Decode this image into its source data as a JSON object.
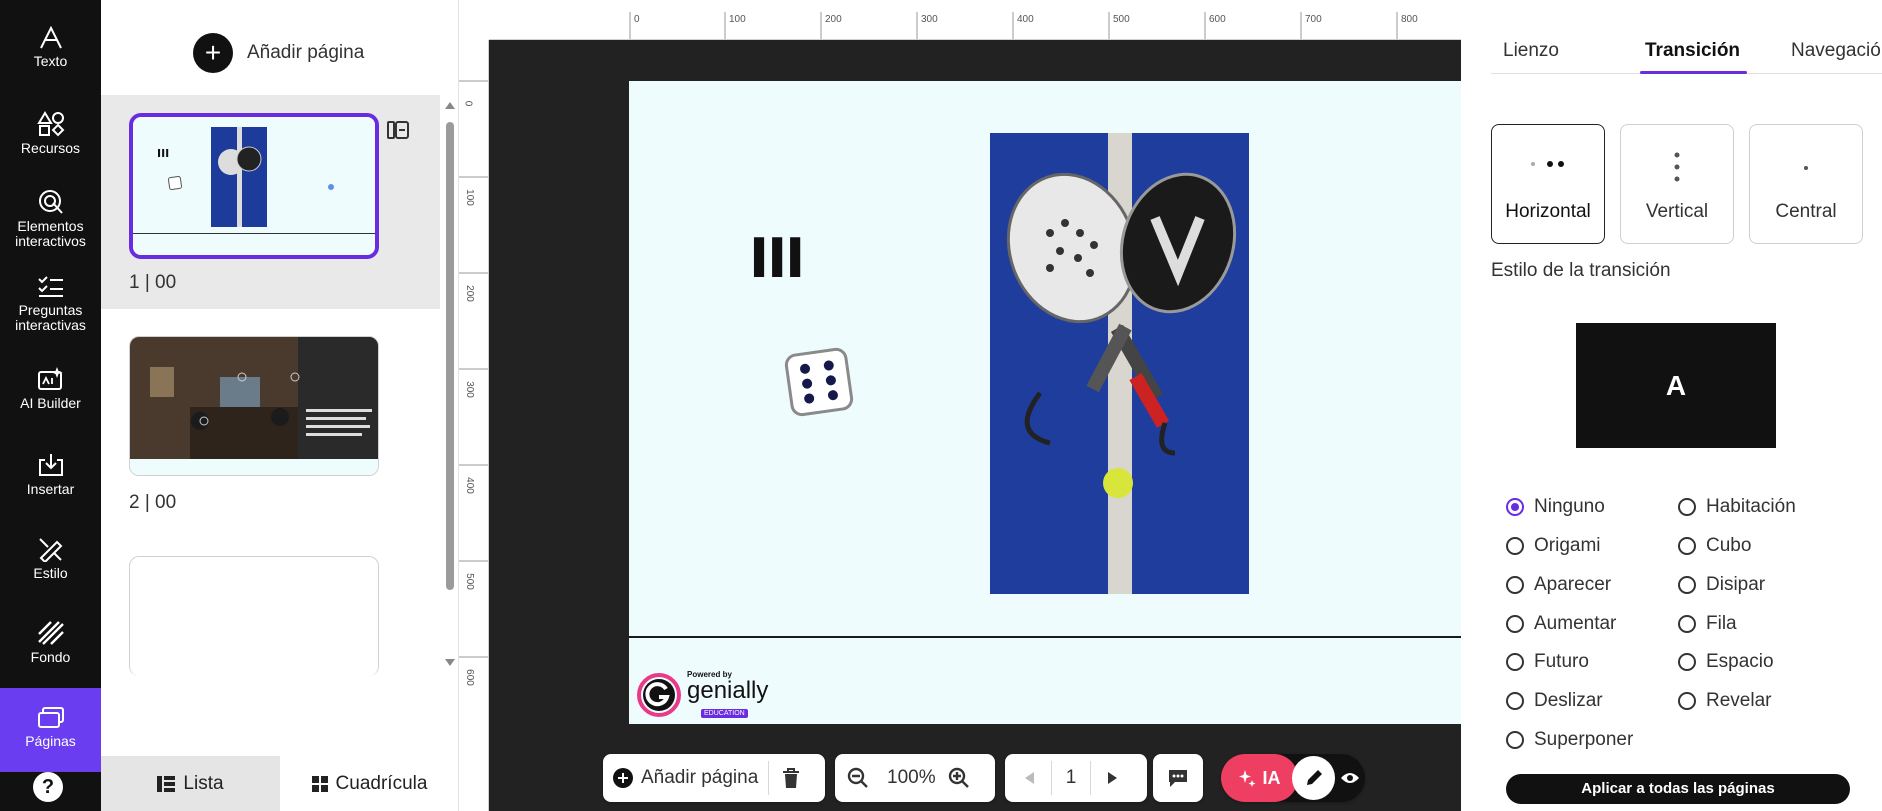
{
  "sidebar": {
    "tools": [
      {
        "label": "Texto",
        "icon": "text-icon"
      },
      {
        "label": "Recursos",
        "icon": "shapes-icon"
      },
      {
        "label": "Elementos interactivos",
        "icon": "interactive-icon"
      },
      {
        "label": "Preguntas interactivas",
        "icon": "checklist-icon"
      },
      {
        "label": "AI Builder",
        "icon": "ai-builder-icon"
      },
      {
        "label": "Insertar",
        "icon": "insert-icon"
      },
      {
        "label": "Estilo",
        "icon": "style-icon"
      },
      {
        "label": "Fondo",
        "icon": "background-icon"
      },
      {
        "label": "Páginas",
        "icon": "pages-icon"
      }
    ],
    "help": "?"
  },
  "pages_panel": {
    "add_page_label": "Añadir página",
    "pages": [
      {
        "label": "1 | 00",
        "selected": true
      },
      {
        "label": "2 | 00",
        "selected": false
      }
    ],
    "view_tabs": {
      "list": "Lista",
      "grid": "Cuadrícula"
    }
  },
  "rulers": {
    "top": [
      "0",
      "100",
      "200",
      "300",
      "400",
      "500",
      "600",
      "700",
      "800"
    ],
    "left": [
      "0",
      "100",
      "200",
      "300",
      "400",
      "500",
      "600"
    ]
  },
  "slide": {
    "roman_numeral": "III",
    "logo": {
      "powered_by": "Powered by",
      "brand": "genially",
      "badge": "EDUCATION"
    }
  },
  "bottom_toolbar": {
    "add_page_label": "Añadir página",
    "zoom": "100%",
    "page_number": "1",
    "ai_label": "IA"
  },
  "right_panel": {
    "tabs": [
      "Lienzo",
      "Transición",
      "Navegación"
    ],
    "active_tab": "Transición",
    "directions": [
      "Horizontal",
      "Vertical",
      "Central"
    ],
    "selected_direction": "Horizontal",
    "style_title": "Estilo de la transición",
    "preview_letter": "A",
    "options_left": [
      "Ninguno",
      "Origami",
      "Aparecer",
      "Aumentar",
      "Futuro",
      "Deslizar",
      "Superponer"
    ],
    "options_right": [
      "Habitación",
      "Cubo",
      "Disipar",
      "Fila",
      "Espacio",
      "Revelar"
    ],
    "selected_option": "Ninguno",
    "apply_label": "Aplicar a todas las páginas"
  },
  "colors": {
    "accent": "#6a2ce0",
    "toolbar_bg": "#111111",
    "slide_bg": "#eefcfd",
    "ai_button": "#ee3e62"
  }
}
